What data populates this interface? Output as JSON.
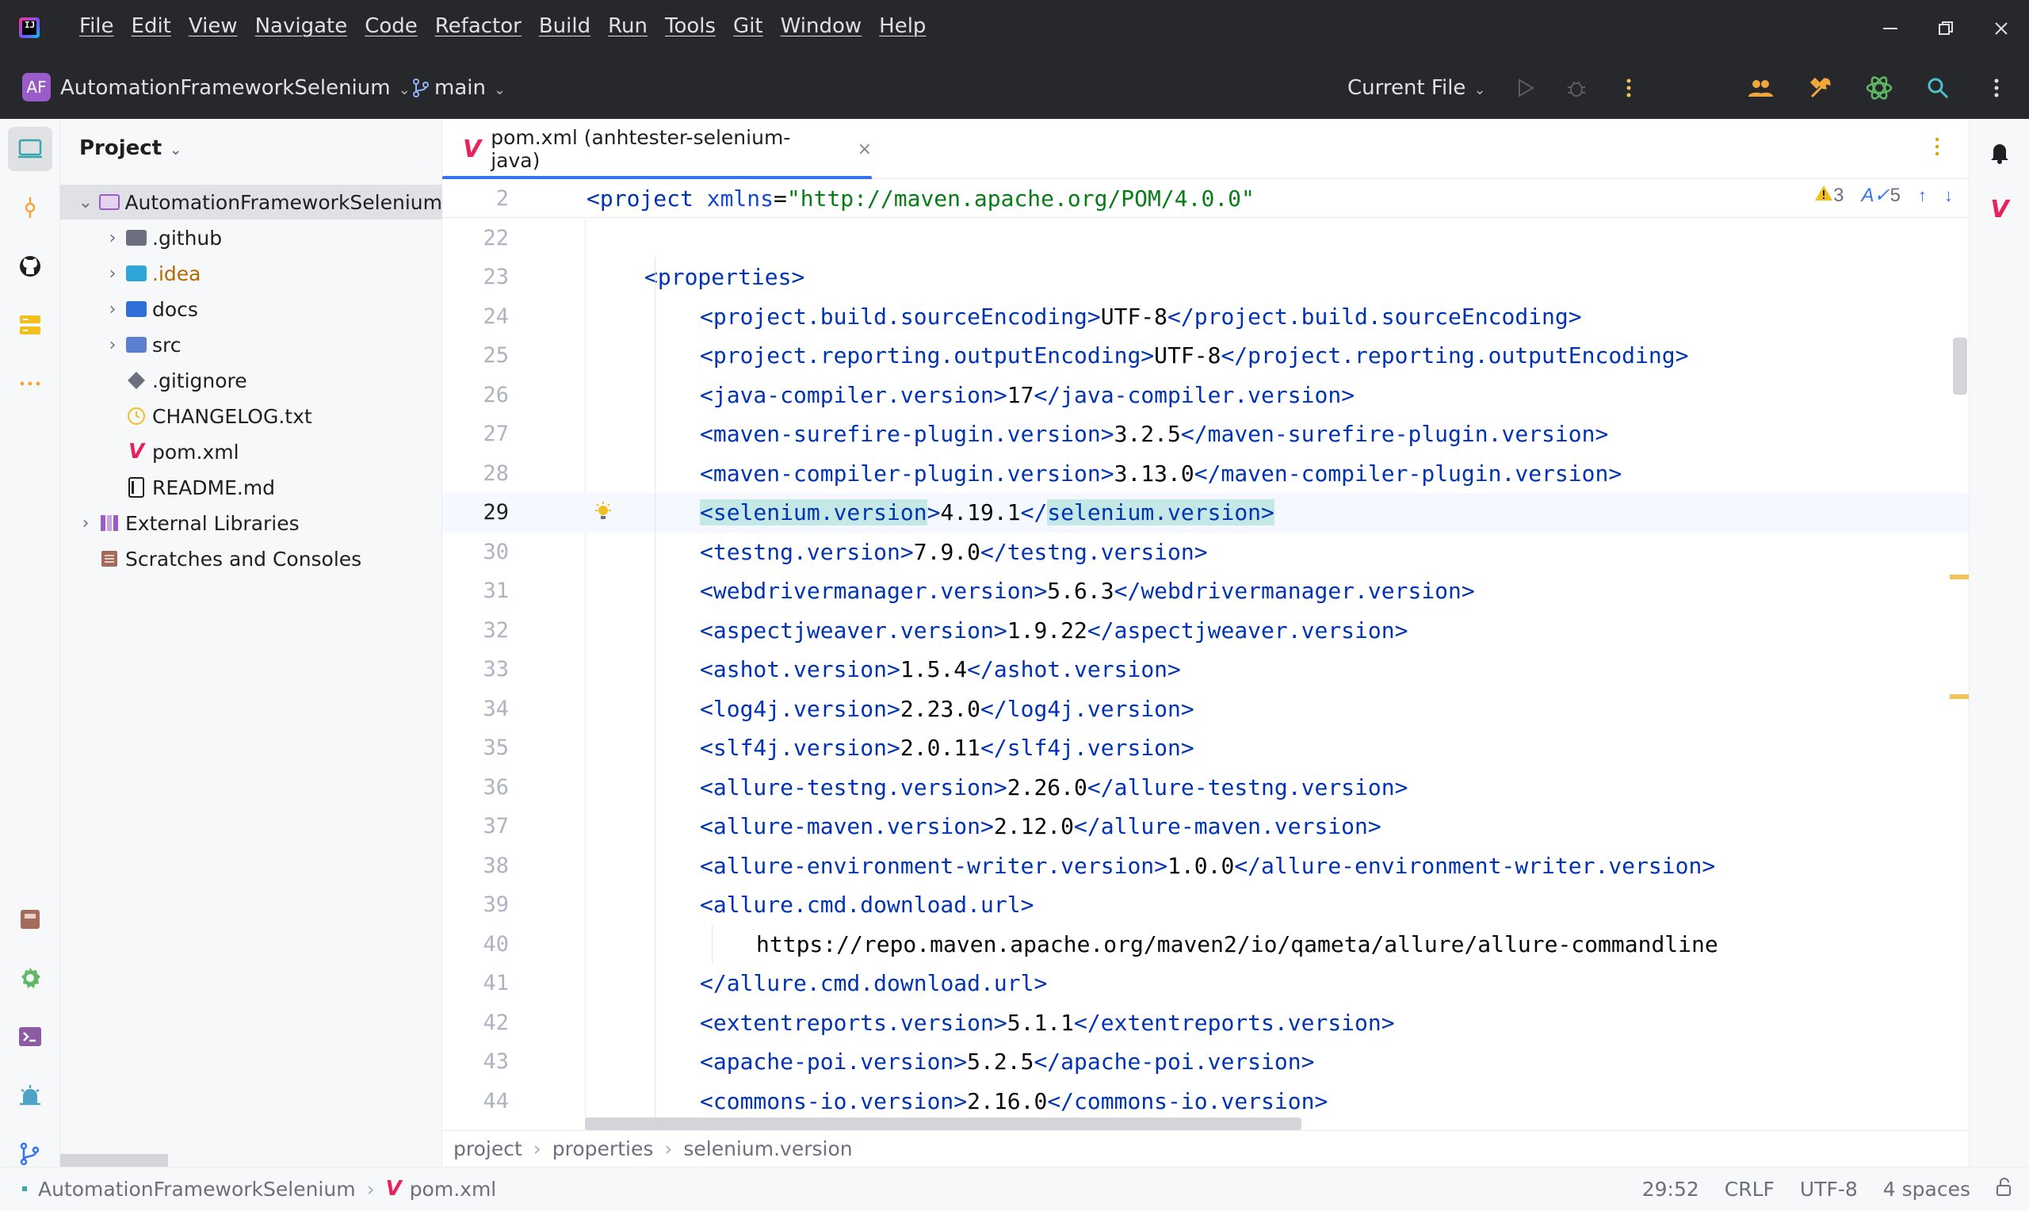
{
  "titlebar": {
    "menu": [
      "File",
      "Edit",
      "View",
      "Navigate",
      "Code",
      "Refactor",
      "Build",
      "Run",
      "Tools",
      "Git",
      "Window",
      "Help"
    ],
    "project_badge": "AF",
    "project_name": "AutomationFrameworkSelenium",
    "branch": "main",
    "run_config": "Current File"
  },
  "project_panel": {
    "title": "Project",
    "tree": [
      {
        "label": "AutomationFrameworkSelenium",
        "kind": "root"
      },
      {
        "label": ".github",
        "kind": "folder"
      },
      {
        "label": ".idea",
        "kind": "folder"
      },
      {
        "label": "docs",
        "kind": "folder"
      },
      {
        "label": "src",
        "kind": "folder"
      },
      {
        "label": ".gitignore",
        "kind": "file"
      },
      {
        "label": "CHANGELOG.txt",
        "kind": "file"
      },
      {
        "label": "pom.xml",
        "kind": "file"
      },
      {
        "label": "README.md",
        "kind": "file"
      },
      {
        "label": "External Libraries",
        "kind": "library"
      },
      {
        "label": "Scratches and Consoles",
        "kind": "scratch"
      }
    ]
  },
  "editor": {
    "tab_label": "pom.xml (anhtester-selenium-java)",
    "tab_close": "×",
    "maven_glyph": "V",
    "inspections": {
      "warnings": "3",
      "typos": "5"
    },
    "sticky": {
      "line": "2",
      "tag_open": "<project",
      "attr": "xmlns",
      "eq": "=",
      "value": "\"http://maven.apache.org/POM/4.0.0\""
    },
    "lines": [
      {
        "n": "22"
      },
      {
        "n": "23",
        "pre": "<",
        "tag": "properties",
        "post": ">"
      },
      {
        "n": "24",
        "tag": "project.build.sourceEncoding",
        "value": "UTF-8"
      },
      {
        "n": "25",
        "tag": "project.reporting.outputEncoding",
        "value": "UTF-8"
      },
      {
        "n": "26",
        "tag": "java-compiler.version",
        "value": "17"
      },
      {
        "n": "27",
        "tag": "maven-surefire-plugin.version",
        "value": "3.2.5"
      },
      {
        "n": "28",
        "tag": "maven-compiler-plugin.version",
        "value": "3.13.0"
      },
      {
        "n": "29",
        "tag": "selenium.version",
        "value": "4.19.1"
      },
      {
        "n": "30",
        "tag": "testng.version",
        "value": "7.9.0"
      },
      {
        "n": "31",
        "tag": "webdrivermanager.version",
        "value": "5.6.3"
      },
      {
        "n": "32",
        "tag": "aspectjweaver.version",
        "value": "1.9.22"
      },
      {
        "n": "33",
        "tag": "ashot.version",
        "value": "1.5.4"
      },
      {
        "n": "34",
        "tag": "log4j.version",
        "value": "2.23.0"
      },
      {
        "n": "35",
        "tag": "slf4j.version",
        "value": "2.0.11"
      },
      {
        "n": "36",
        "tag": "allure-testng.version",
        "value": "2.26.0"
      },
      {
        "n": "37",
        "tag": "allure-maven.version",
        "value": "2.12.0"
      },
      {
        "n": "38",
        "tag": "allure-environment-writer.version",
        "value": "1.0.0"
      },
      {
        "n": "39",
        "tag": "allure.cmd.download.url",
        "open_only": true
      },
      {
        "n": "40",
        "text": "https://repo.maven.apache.org/maven2/io/qameta/allure/allure-commandline"
      },
      {
        "n": "41",
        "tag": "allure.cmd.download.url",
        "close_only": true
      },
      {
        "n": "42",
        "tag": "extentreports.version",
        "value": "5.1.1"
      },
      {
        "n": "43",
        "tag": "apache-poi.version",
        "value": "5.2.5"
      },
      {
        "n": "44",
        "tag": "commons-io.version",
        "value": "2.16.0"
      }
    ],
    "breadcrumbs": [
      "project",
      "properties",
      "selenium.version"
    ]
  },
  "statusbar": {
    "project": "AutomationFrameworkSelenium",
    "file": "pom.xml",
    "position": "29:52",
    "line_sep": "CRLF",
    "encoding": "UTF-8",
    "indent": "4 spaces"
  },
  "colors": {
    "tag": "#0033b3",
    "string": "#067d17",
    "accent": "#3574f0",
    "maven": "#e8235c",
    "highlight": "#c4e8e6"
  }
}
